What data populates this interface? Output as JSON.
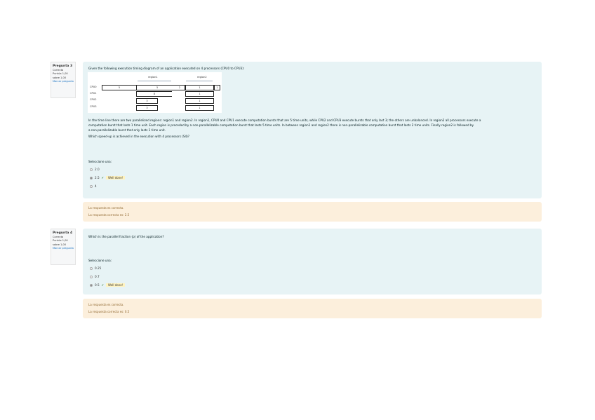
{
  "q3": {
    "number": "Pregunta 3",
    "state": "Correcta",
    "grade": "Puntúa 1,00 sobre 1,00",
    "flag": "Marcar pregunta",
    "text": "Given the following execution timing diagram of an application executed on 4 processors (CPU0 to CPU3):",
    "diagram": {
      "headers": [
        "region1",
        "region2"
      ],
      "cpus": [
        "CPU0",
        "CPU1",
        "CPU2",
        "CPU3"
      ],
      "cpu0": [
        "5",
        "5",
        "2",
        "1",
        "1"
      ],
      "cpu1": [
        "8",
        "1"
      ],
      "cpu2": [
        "3",
        "1"
      ],
      "cpu3": [
        "3",
        "1"
      ]
    },
    "para1": "In the time line there are two parallelized regions: region1 and region2. In region1, CPU0 and CPU1 execute computation bursts that are 5 time units, while CPU2 and CPU3 execute bursts that only last 3; the others are unbalanced. In region2 all processors execute a",
    "para2": "computation burst that lasts 1 time unit. Each region is preceded by a non-parallelizable computation burst that lasts 5 time units. In between region1 and region2 there is non-parallelizable computation burst that lasts 2 time units. Finally region2 is followed by",
    "para3": "a non-parallelizable burst that only lasts 1 time unit.",
    "question": "Which speed-up is achieved in the execution with 4 processors (S4)?",
    "prompt": "Seleccione una:",
    "options": [
      {
        "label": "2.0"
      },
      {
        "label": "2.5",
        "feedback": "Well done!"
      },
      {
        "label": "4"
      }
    ],
    "feedback": [
      "La respuesta es correcta.",
      "La respuesta correcta es: 2.5"
    ]
  },
  "q4": {
    "number": "Pregunta 4",
    "state": "Correcta",
    "grade": "Puntúa 1,00 sobre 1,00",
    "flag": "Marcar pregunta",
    "text": "Which is the parallel fraction (p) of the application?",
    "prompt": "Seleccione una:",
    "options": [
      {
        "label": "0.25"
      },
      {
        "label": "0.7"
      },
      {
        "label": "0.5",
        "feedback": "Well done!"
      }
    ],
    "feedback": [
      "La respuesta es correcta.",
      "La respuesta correcta es: 0.5"
    ]
  },
  "colors": {
    "question_bg": "#e7f3f5",
    "feedback_bg": "#fcefdc",
    "correct": "#357a32"
  }
}
